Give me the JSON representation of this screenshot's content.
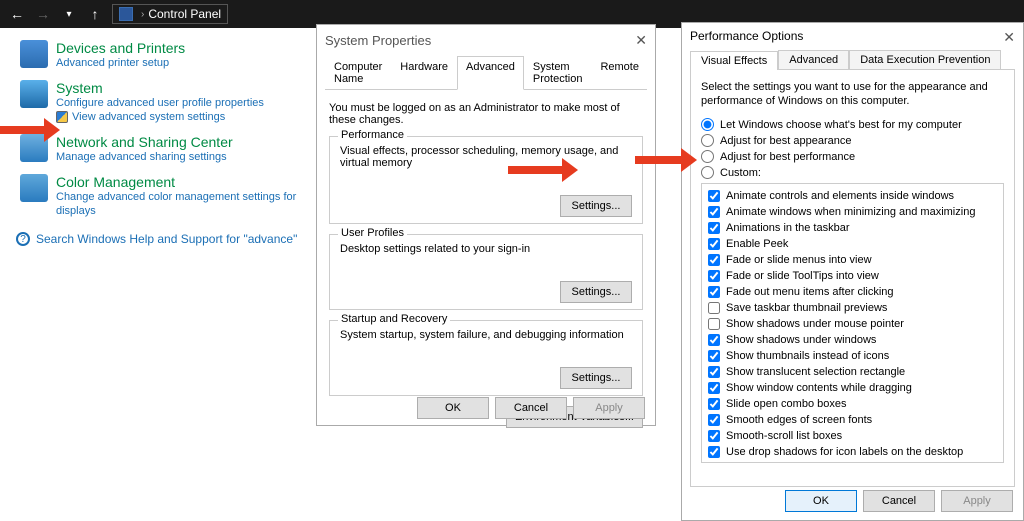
{
  "nav": {
    "breadcrumb": "Control Panel"
  },
  "cp": {
    "items": [
      {
        "head": "Devices and Printers",
        "subs": [
          "Advanced printer setup"
        ]
      },
      {
        "head": "System",
        "subs": [
          "Configure advanced user profile properties",
          "View advanced system settings"
        ],
        "shield_on": 1
      },
      {
        "head": "Network and Sharing Center",
        "subs": [
          "Manage advanced sharing settings"
        ]
      },
      {
        "head": "Color Management",
        "subs": [
          "Change advanced color management settings for displays"
        ]
      }
    ],
    "search": "Search Windows Help and Support for \"advance\""
  },
  "sys": {
    "title": "System Properties",
    "tabs": [
      "Computer Name",
      "Hardware",
      "Advanced",
      "System Protection",
      "Remote"
    ],
    "note": "You must be logged on as an Administrator to make most of these changes.",
    "groups": {
      "perf": {
        "legend": "Performance",
        "desc": "Visual effects, processor scheduling, memory usage, and virtual memory",
        "btn": "Settings..."
      },
      "user": {
        "legend": "User Profiles",
        "desc": "Desktop settings related to your sign-in",
        "btn": "Settings..."
      },
      "start": {
        "legend": "Startup and Recovery",
        "desc": "System startup, system failure, and debugging information",
        "btn": "Settings..."
      }
    },
    "envbtn": "Environment Variables...",
    "ok": "OK",
    "cancel": "Cancel",
    "apply": "Apply"
  },
  "perf": {
    "title": "Performance Options",
    "tabs": [
      "Visual Effects",
      "Advanced",
      "Data Execution Prevention"
    ],
    "note": "Select the settings you want to use for the appearance and performance of Windows on this computer.",
    "radios": [
      {
        "label": "Let Windows choose what's best for my computer",
        "checked": true
      },
      {
        "label": "Adjust for best appearance",
        "checked": false
      },
      {
        "label": "Adjust for best performance",
        "checked": false
      },
      {
        "label": "Custom:",
        "checked": false
      }
    ],
    "checks": [
      {
        "label": "Animate controls and elements inside windows",
        "checked": true
      },
      {
        "label": "Animate windows when minimizing and maximizing",
        "checked": true
      },
      {
        "label": "Animations in the taskbar",
        "checked": true
      },
      {
        "label": "Enable Peek",
        "checked": true
      },
      {
        "label": "Fade or slide menus into view",
        "checked": true
      },
      {
        "label": "Fade or slide ToolTips into view",
        "checked": true
      },
      {
        "label": "Fade out menu items after clicking",
        "checked": true
      },
      {
        "label": "Save taskbar thumbnail previews",
        "checked": false
      },
      {
        "label": "Show shadows under mouse pointer",
        "checked": false
      },
      {
        "label": "Show shadows under windows",
        "checked": true
      },
      {
        "label": "Show thumbnails instead of icons",
        "checked": true
      },
      {
        "label": "Show translucent selection rectangle",
        "checked": true
      },
      {
        "label": "Show window contents while dragging",
        "checked": true
      },
      {
        "label": "Slide open combo boxes",
        "checked": true
      },
      {
        "label": "Smooth edges of screen fonts",
        "checked": true
      },
      {
        "label": "Smooth-scroll list boxes",
        "checked": true
      },
      {
        "label": "Use drop shadows for icon labels on the desktop",
        "checked": true
      }
    ],
    "ok": "OK",
    "cancel": "Cancel",
    "apply": "Apply"
  }
}
